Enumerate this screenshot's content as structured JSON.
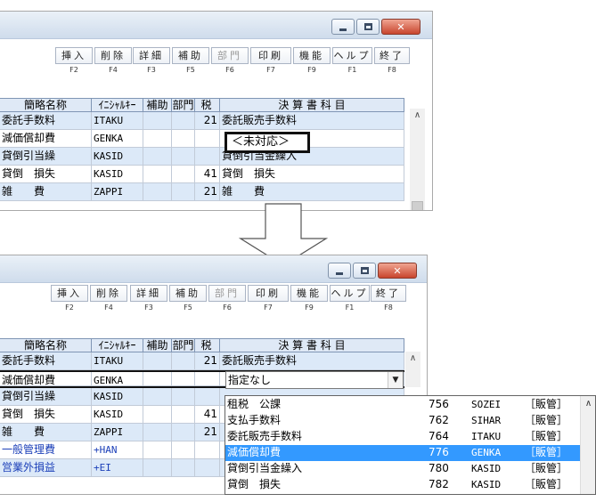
{
  "window": {
    "controls": {
      "minimize": "minimize",
      "maximize": "maximize",
      "close": "close"
    }
  },
  "toolbar": {
    "buttons": [
      {
        "label": "挿入",
        "fkey": "F2",
        "enabled": true
      },
      {
        "label": "削除",
        "fkey": "F4",
        "enabled": true
      },
      {
        "label": "詳細",
        "fkey": "F3",
        "enabled": true
      },
      {
        "label": "補助",
        "fkey": "F5",
        "enabled": true
      },
      {
        "label": "部門",
        "fkey": "F6",
        "enabled": false
      },
      {
        "label": "印刷",
        "fkey": "F7",
        "enabled": true
      },
      {
        "label": "機能",
        "fkey": "F9",
        "enabled": true
      },
      {
        "label": "ヘルプ",
        "fkey": "F1",
        "enabled": true
      },
      {
        "label": "終了",
        "fkey": "F8",
        "enabled": true
      }
    ]
  },
  "table": {
    "headers": [
      "簡略名称",
      "ｲﾆｼｬﾙｷｰ",
      "補助",
      "部門",
      "税",
      "決 算 書 科 目"
    ]
  },
  "before": {
    "rows": [
      {
        "name": "委託手数料",
        "key": "ITAKU",
        "tax": "21",
        "account": "委託販売手数料"
      },
      {
        "name": "減価償却費",
        "key": "GENKA",
        "tax": "",
        "account": "＜未対応＞"
      },
      {
        "name": "貸倒引当繰",
        "key": "KASID",
        "tax": "",
        "account": "貸倒引当金繰入"
      },
      {
        "name": "貸倒　損失",
        "key": "KASID",
        "tax": "41",
        "account": "貸倒　損失"
      },
      {
        "name": "雑　　費",
        "key": "ZAPPI",
        "tax": "21",
        "account": "雑　　費"
      }
    ]
  },
  "after": {
    "rows": [
      {
        "name": "委託手数料",
        "key": "ITAKU",
        "tax": "21",
        "account": "委託販売手数料"
      },
      {
        "name": "減価償却費",
        "key": "GENKA",
        "tax": "",
        "account": "指定なし"
      },
      {
        "name": "貸倒引当繰",
        "key": "KASID",
        "tax": "",
        "account": ""
      },
      {
        "name": "貸倒　損失",
        "key": "KASID",
        "tax": "41",
        "account": ""
      },
      {
        "name": "雑　　費",
        "key": "ZAPPI",
        "tax": "21",
        "account": ""
      },
      {
        "name": "一般管理費",
        "key": "+HAN",
        "tax": "",
        "account": ""
      },
      {
        "name": "営業外損益",
        "key": "+EI",
        "tax": "",
        "account": ""
      }
    ],
    "combo_value": "指定なし",
    "dropdown_items": [
      {
        "name": "租税　公課",
        "code": "756",
        "key": "SOZEI",
        "cat": "［販管］",
        "selected": false
      },
      {
        "name": "支払手数料",
        "code": "762",
        "key": "SIHAR",
        "cat": "［販管］",
        "selected": false
      },
      {
        "name": "委託販売手数料",
        "code": "764",
        "key": "ITAKU",
        "cat": "［販管］",
        "selected": false
      },
      {
        "name": "減価償却費",
        "code": "776",
        "key": "GENKA",
        "cat": "［販管］",
        "selected": true
      },
      {
        "name": "貸倒引当金繰入",
        "code": "780",
        "key": "KASID",
        "cat": "［販管］",
        "selected": false
      },
      {
        "name": "貸倒　損失",
        "code": "782",
        "key": "KASID",
        "cat": "［販管］",
        "selected": false
      }
    ]
  },
  "colors": {
    "selection": "#3399ff",
    "row_alt": "#dce9f8",
    "header": "#dfe9f6",
    "link_blue": "#1b3fb8"
  }
}
